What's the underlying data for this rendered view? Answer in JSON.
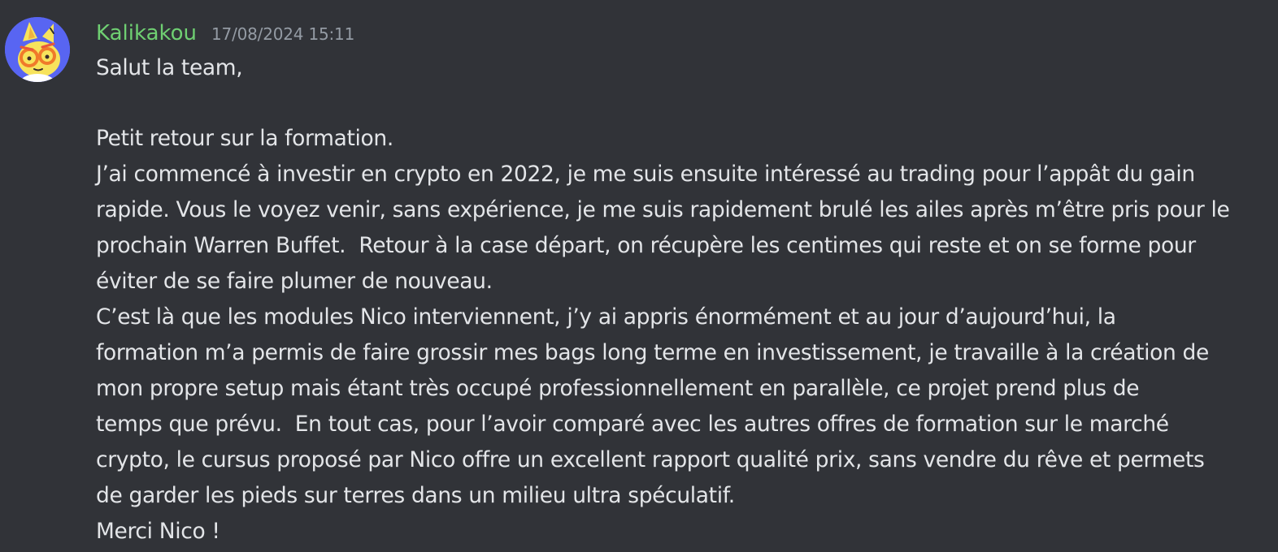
{
  "message": {
    "author": "Kalikakou",
    "timestamp": "17/08/2024 15:11",
    "colors": {
      "background": "#313338",
      "username": "#6fcf72",
      "timestamp": "#949ba4",
      "text": "#e3e5e8",
      "avatar_bg": "#5865f2"
    },
    "avatar_icon": "yellow-cat-with-glasses-avatar",
    "lines": [
      "Salut la team,",
      "",
      "Petit retour sur la formation.",
      "J’ai commencé à investir en crypto en 2022, je me suis ensuite intéressé au trading pour l’appât du gain",
      "rapide. Vous le voyez venir, sans expérience, je me suis rapidement brulé les ailes après m’être pris pour le",
      "prochain Warren Buffet.  Retour à la case départ, on récupère les centimes qui reste et on se forme pour",
      "éviter de se faire plumer de nouveau.",
      "C’est là que les modules Nico interviennent, j’y ai appris énormément et au jour d’aujourd’hui, la",
      "formation m’a permis de faire grossir mes bags long terme en investissement, je travaille à la création de",
      "mon propre setup mais étant très occupé professionnellement en parallèle, ce projet prend plus de",
      "temps que prévu.  En tout cas, pour l’avoir comparé avec les autres offres de formation sur le marché",
      "crypto, le cursus proposé par Nico offre un excellent rapport qualité prix, sans vendre du rêve et permets",
      "de garder les pieds sur terres dans un milieu ultra spéculatif.",
      "Merci Nico !"
    ]
  }
}
